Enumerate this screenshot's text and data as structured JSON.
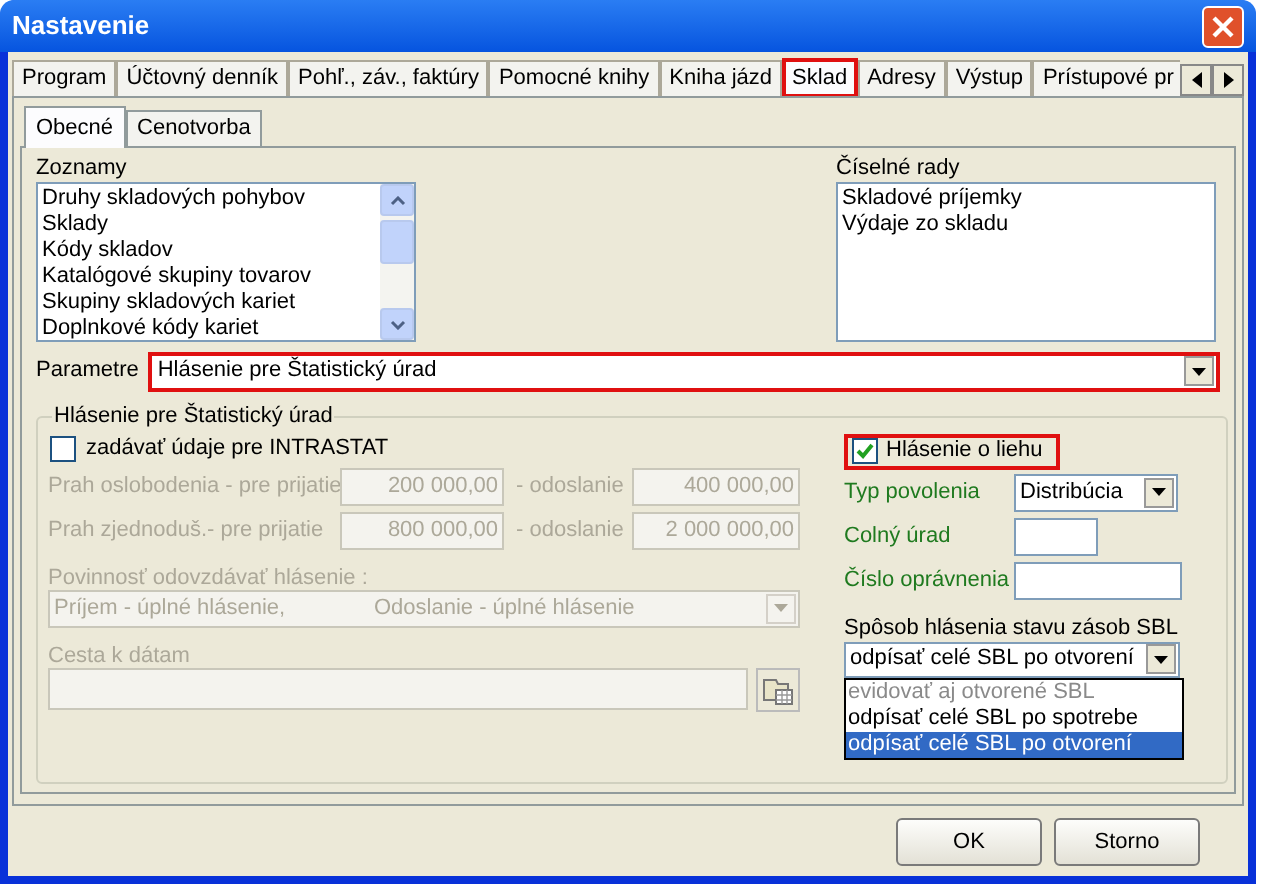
{
  "window": {
    "title": "Nastavenie"
  },
  "tabs": [
    {
      "label": "Program",
      "selected": false,
      "highlighted": false
    },
    {
      "label": "Účtovný denník",
      "selected": false,
      "highlighted": false
    },
    {
      "label": "Pohľ., záv., faktúry",
      "selected": false,
      "highlighted": false
    },
    {
      "label": "Pomocné knihy",
      "selected": false,
      "highlighted": false
    },
    {
      "label": "Kniha jázd",
      "selected": false,
      "highlighted": false
    },
    {
      "label": "Sklad",
      "selected": true,
      "highlighted": true
    },
    {
      "label": "Adresy",
      "selected": false,
      "highlighted": false
    },
    {
      "label": "Výstup",
      "selected": false,
      "highlighted": false
    },
    {
      "label": "Prístupové pr",
      "selected": false,
      "highlighted": false
    }
  ],
  "subtabs": [
    {
      "label": "Obecné",
      "selected": true
    },
    {
      "label": "Cenotvorba",
      "selected": false
    }
  ],
  "lists": {
    "label": "Zoznamy",
    "items": [
      "Druhy skladových pohybov",
      "Sklady",
      "Kódy skladov",
      "Katalógové skupiny tovarov",
      "Skupiny skladových kariet",
      "Doplnkové kódy kariet"
    ]
  },
  "number_series": {
    "label": "Číselné rady",
    "items": [
      "Skladové príjemky",
      "Výdaje zo skladu"
    ]
  },
  "parameters": {
    "label": "Parametre",
    "value": "Hlásenie pre Štatistický úrad",
    "highlighted": true
  },
  "statistics_group": {
    "title": "Hlásenie pre Štatistický úrad",
    "intrastat": {
      "label": "zadávať údaje pre INTRASTAT",
      "checked": false
    },
    "thresholds": [
      {
        "label": "Prah oslobodenia - pre prijatie",
        "receive": "200 000,00",
        "send_label": "- odoslanie",
        "send": "400 000,00",
        "disabled": true
      },
      {
        "label": "Prah zjednoduš.- pre prijatie",
        "receive": "800 000,00",
        "send_label": "- odoslanie",
        "send": "2 000 000,00",
        "disabled": true
      }
    ],
    "obligation": {
      "label": "Povinnosť odovzdávať hlásenie :",
      "receive": "Príjem - úplné hlásenie,",
      "send": "Odoslanie - úplné hlásenie",
      "disabled": true
    },
    "data_path": {
      "label": "Cesta k dátam",
      "disabled": true
    }
  },
  "alcohol": {
    "checkbox": {
      "label": "Hlásenie o liehu",
      "checked": true,
      "highlighted": true
    },
    "fields": [
      {
        "kind": "select",
        "label": "Typ povolenia",
        "value": "Distribúcia"
      },
      {
        "kind": "text",
        "label": "Colný úrad"
      },
      {
        "kind": "text",
        "label": "Číslo oprávnenia"
      }
    ],
    "method": {
      "label": "Spôsob hlásenia stavu zásob SBL",
      "value": "odpísať celé SBL po otvorení",
      "options": [
        {
          "label": "evidovať aj otvorené SBL",
          "selected": false,
          "disabled": true
        },
        {
          "label": "odpísať celé SBL po spotrebe",
          "selected": false,
          "disabled": false
        },
        {
          "label": "odpísať celé SBL po otvorení",
          "selected": true,
          "disabled": false
        }
      ]
    }
  },
  "buttons": [
    {
      "label": "OK"
    },
    {
      "label": "Storno"
    }
  ]
}
